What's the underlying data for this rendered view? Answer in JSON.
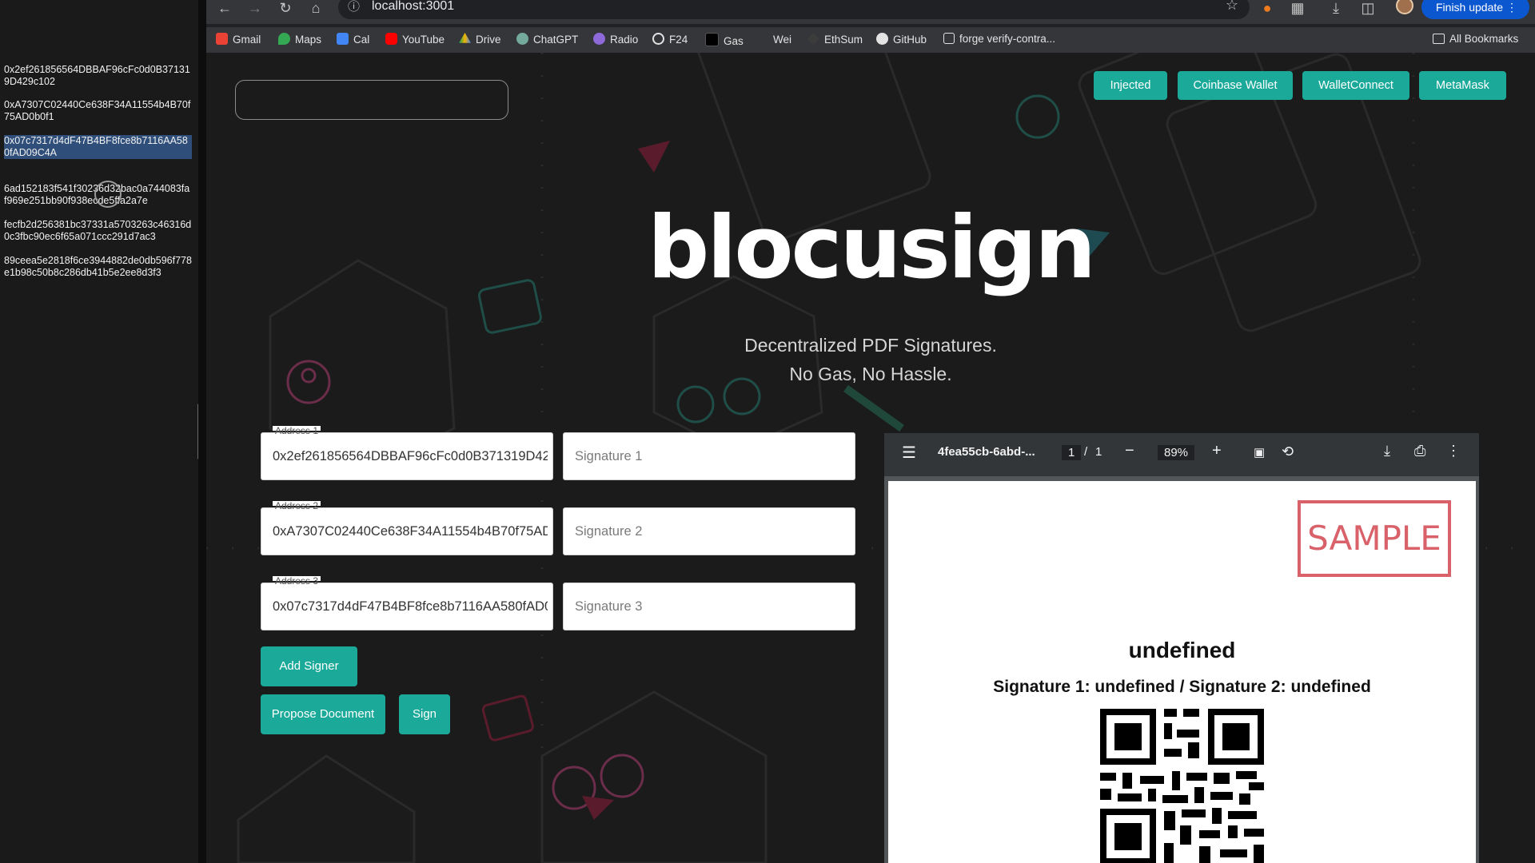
{
  "notes_panel": {
    "entries": [
      "0x2ef261856564DBBAF96cFc0d0B371319D429c102",
      "0xA7307C02440Ce638F34A11554b4B70f75AD0b0f1",
      "0x07c7317d4dF47B4BF8fce8b7116AA580fAD09C4A",
      "6ad152183f541f30236d32bac0a744083faf969e251bb90f938ecde5ffa2a7e",
      "fecfb2d256381bc37331a5703263c46316d0c3fbc90ec6f65a071ccc291d7ac3",
      "89ceea5e2818f6ce3944882de0db596f778e1b98c50b8c286db41b5e2ee8d3f3"
    ]
  },
  "browser": {
    "url": "localhost:3001",
    "update_button": "Finish update",
    "bookmarks": [
      "Gmail",
      "Maps",
      "Cal",
      "YouTube",
      "Drive",
      "ChatGPT",
      "Radio",
      "F24",
      "Gas",
      "Wei",
      "EthSum",
      "GitHub",
      "forge verify-contra..."
    ],
    "all_bookmarks": "All Bookmarks"
  },
  "page": {
    "title": "blocusign",
    "tagline_1": "Decentralized PDF Signatures.",
    "tagline_2": "No Gas, No Hassle.",
    "wallet_buttons": [
      "Injected",
      "Coinbase Wallet",
      "WalletConnect",
      "MetaMask"
    ],
    "signers": [
      {
        "address_label": "Address 1",
        "address": "0x2ef261856564DBBAF96cFc0d0B371319D429c102",
        "signature_placeholder": "Signature 1"
      },
      {
        "address_label": "Address 2",
        "address": "0xA7307C02440Ce638F34A11554b4B70f75AD0b0f1",
        "signature_placeholder": "Signature 2"
      },
      {
        "address_label": "Address 3",
        "address": "0x07c7317d4dF47B4BF8fce8b7116AA580fAD09C4A",
        "signature_placeholder": "Signature 3"
      }
    ],
    "add_signer": "Add Signer",
    "propose_document": "Propose Document",
    "sign": "Sign"
  },
  "pdf": {
    "filename": "4fea55cb-6abd-...",
    "page_current": "1",
    "page_sep": "/",
    "page_total": "1",
    "zoom": "89%",
    "stamp": "SAMPLE",
    "doc_title": "undefined",
    "doc_signatures": "Signature 1: undefined / Signature 2: undefined"
  },
  "icons": {
    "menu": "hamburger-icon",
    "download": "download-icon",
    "print": "print-icon",
    "more": "kebab-icon"
  },
  "colors": {
    "accent": "#1ba99a",
    "stamp": "#d8616a",
    "chrome_update": "#0b57d0"
  }
}
